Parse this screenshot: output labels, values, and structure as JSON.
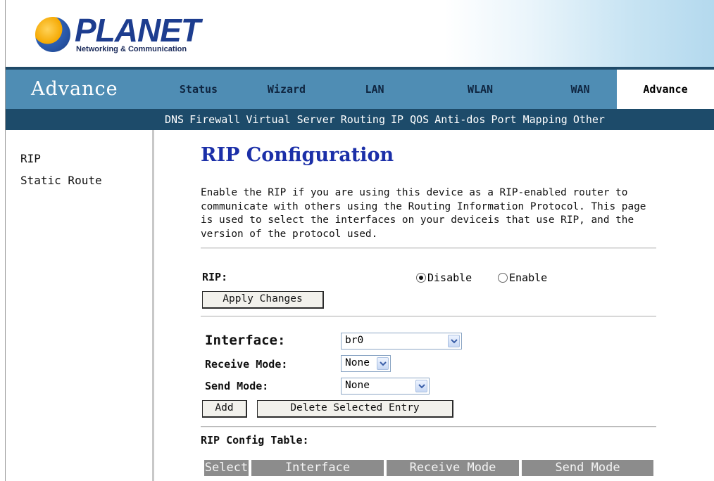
{
  "brand": {
    "name": "PLANET",
    "tagline": "Networking & Communication"
  },
  "section_title": "Advance",
  "main_tabs": [
    {
      "label": "Status",
      "active": false
    },
    {
      "label": "Wizard",
      "active": false
    },
    {
      "label": "LAN",
      "active": false
    },
    {
      "label": "WLAN",
      "active": false
    },
    {
      "label": "WAN",
      "active": false
    },
    {
      "label": "Advance",
      "active": true
    }
  ],
  "sub_tabs": [
    "DNS",
    "Firewall",
    "Virtual Server",
    "Routing",
    "IP QOS",
    "Anti-dos",
    "Port Mapping",
    "Other"
  ],
  "sidebar": {
    "items": [
      "RIP",
      "Static Route"
    ]
  },
  "page": {
    "title": "RIP Configuration",
    "description": "Enable the RIP if you are using this device as a RIP-enabled router to communicate with others using the Routing Information Protocol. This page is used to select the interfaces on your deviceis that use RIP, and the version of the protocol used."
  },
  "rip": {
    "label": "RIP:",
    "options": [
      {
        "label": "Disable",
        "selected": true
      },
      {
        "label": "Enable",
        "selected": false
      }
    ],
    "apply_label": "Apply Changes"
  },
  "form": {
    "interface_label": "Interface:",
    "interface_value": "br0",
    "receive_mode_label": "Receive Mode:",
    "receive_mode_value": "None",
    "send_mode_label": "Send Mode:",
    "send_mode_value": "None",
    "add_label": "Add",
    "delete_label": "Delete Selected Entry"
  },
  "table": {
    "title": "RIP Config Table:",
    "columns": [
      "Select",
      "Interface",
      "Receive Mode",
      "Send Mode"
    ]
  },
  "colors": {
    "nav_bg": "#4f8db4",
    "subnav_bg": "#1d4b6a",
    "title_blue": "#1b2fa8",
    "table_header": "#8c8c8c"
  }
}
